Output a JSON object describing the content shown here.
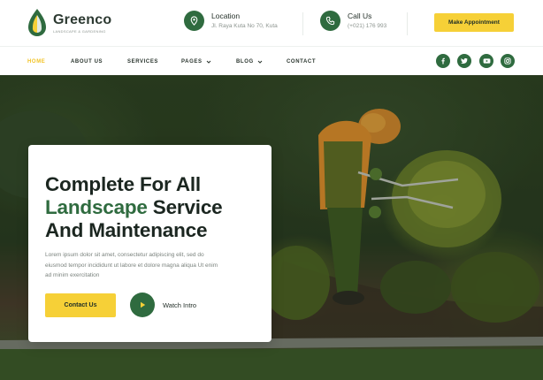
{
  "brand": {
    "name": "Greenco",
    "tagline": "Landscape & Gardening",
    "logo_icon": "leaf-drop-logo"
  },
  "header": {
    "location": {
      "title": "Location",
      "value": "Jl. Raya Kuta No 70, Kuta",
      "icon": "map-pin-icon"
    },
    "call": {
      "title": "Call Us",
      "value": "(+021) 176 993",
      "icon": "phone-icon"
    },
    "cta_label": "Make Appointment"
  },
  "nav": {
    "items": [
      {
        "label": "HOME",
        "active": true
      },
      {
        "label": "ABOUT US"
      },
      {
        "label": "SERVICES"
      },
      {
        "label": "PAGES",
        "dropdown": true
      },
      {
        "label": "BLOG",
        "dropdown": true
      },
      {
        "label": "CONTACT"
      }
    ],
    "social": [
      "facebook-icon",
      "twitter-icon",
      "youtube-icon",
      "instagram-icon"
    ]
  },
  "hero": {
    "line1": "Complete For All",
    "line2_highlight": "Landscape",
    "line2_rest": " Service",
    "line3": "And Maintenance",
    "body": "Lorem ipsum dolor sit amet, consectetur adipiscing elit, sed do eiusmod tempor incididunt ut labore et dolore magna aliqua Ut enim ad minim exercitation",
    "primary_label": "Contact Us",
    "secondary_label": "Watch Intro"
  },
  "colors": {
    "brand_green": "#2f6b3f",
    "accent_yellow": "#f6d037",
    "active_nav": "#f2c326"
  }
}
